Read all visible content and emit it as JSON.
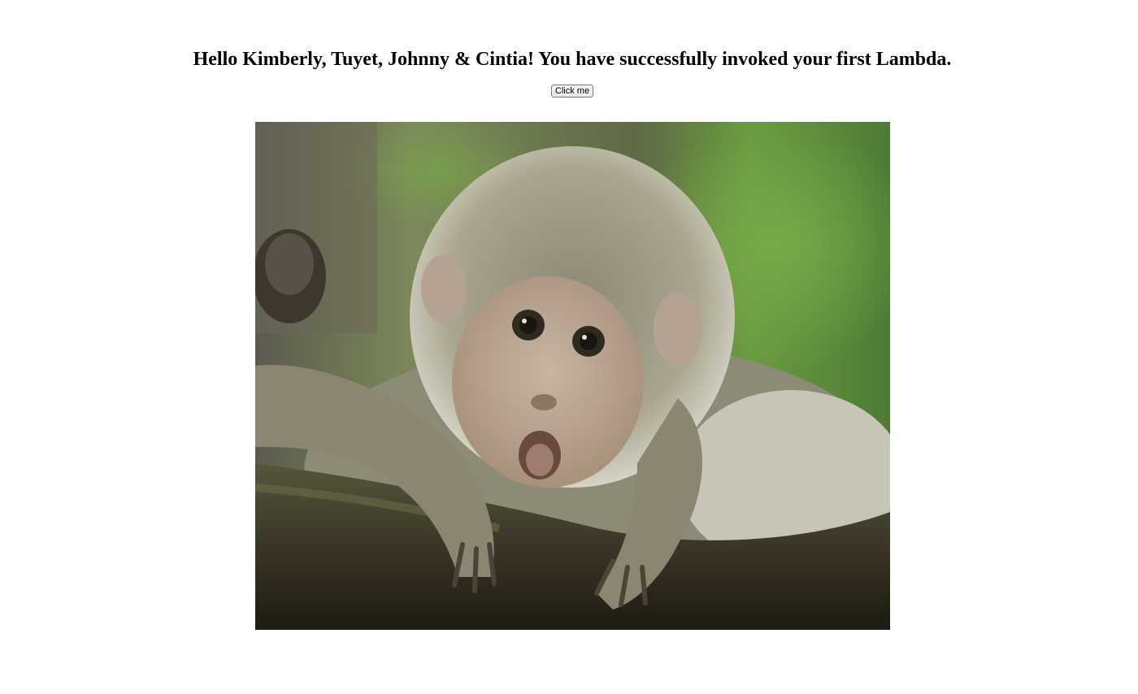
{
  "page": {
    "heading": "Hello Kimberly, Tuyet, Johnny & Cintia! You have successfully invoked your first Lambda.",
    "button_label": "Click me"
  },
  "photo": {
    "subject": "baby macaque monkey resting on a mossy branch",
    "colors": {
      "background_green": "#6a9a40",
      "background_dark": "#3a3a2c",
      "fur": "#a8a490",
      "face": "#bfae9a",
      "branch": "#2a2418"
    }
  }
}
